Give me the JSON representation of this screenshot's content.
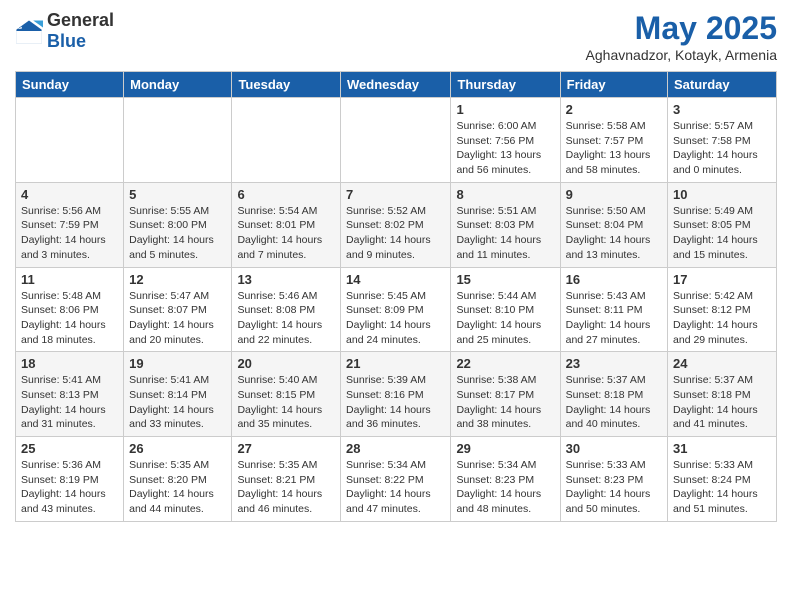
{
  "header": {
    "logo_general": "General",
    "logo_blue": "Blue",
    "title": "May 2025",
    "subtitle": "Aghavnadzor, Kotayk, Armenia"
  },
  "calendar": {
    "days_of_week": [
      "Sunday",
      "Monday",
      "Tuesday",
      "Wednesday",
      "Thursday",
      "Friday",
      "Saturday"
    ],
    "weeks": [
      [
        {
          "day": "",
          "info": ""
        },
        {
          "day": "",
          "info": ""
        },
        {
          "day": "",
          "info": ""
        },
        {
          "day": "",
          "info": ""
        },
        {
          "day": "1",
          "info": "Sunrise: 6:00 AM\nSunset: 7:56 PM\nDaylight: 13 hours\nand 56 minutes."
        },
        {
          "day": "2",
          "info": "Sunrise: 5:58 AM\nSunset: 7:57 PM\nDaylight: 13 hours\nand 58 minutes."
        },
        {
          "day": "3",
          "info": "Sunrise: 5:57 AM\nSunset: 7:58 PM\nDaylight: 14 hours\nand 0 minutes."
        }
      ],
      [
        {
          "day": "4",
          "info": "Sunrise: 5:56 AM\nSunset: 7:59 PM\nDaylight: 14 hours\nand 3 minutes."
        },
        {
          "day": "5",
          "info": "Sunrise: 5:55 AM\nSunset: 8:00 PM\nDaylight: 14 hours\nand 5 minutes."
        },
        {
          "day": "6",
          "info": "Sunrise: 5:54 AM\nSunset: 8:01 PM\nDaylight: 14 hours\nand 7 minutes."
        },
        {
          "day": "7",
          "info": "Sunrise: 5:52 AM\nSunset: 8:02 PM\nDaylight: 14 hours\nand 9 minutes."
        },
        {
          "day": "8",
          "info": "Sunrise: 5:51 AM\nSunset: 8:03 PM\nDaylight: 14 hours\nand 11 minutes."
        },
        {
          "day": "9",
          "info": "Sunrise: 5:50 AM\nSunset: 8:04 PM\nDaylight: 14 hours\nand 13 minutes."
        },
        {
          "day": "10",
          "info": "Sunrise: 5:49 AM\nSunset: 8:05 PM\nDaylight: 14 hours\nand 15 minutes."
        }
      ],
      [
        {
          "day": "11",
          "info": "Sunrise: 5:48 AM\nSunset: 8:06 PM\nDaylight: 14 hours\nand 18 minutes."
        },
        {
          "day": "12",
          "info": "Sunrise: 5:47 AM\nSunset: 8:07 PM\nDaylight: 14 hours\nand 20 minutes."
        },
        {
          "day": "13",
          "info": "Sunrise: 5:46 AM\nSunset: 8:08 PM\nDaylight: 14 hours\nand 22 minutes."
        },
        {
          "day": "14",
          "info": "Sunrise: 5:45 AM\nSunset: 8:09 PM\nDaylight: 14 hours\nand 24 minutes."
        },
        {
          "day": "15",
          "info": "Sunrise: 5:44 AM\nSunset: 8:10 PM\nDaylight: 14 hours\nand 25 minutes."
        },
        {
          "day": "16",
          "info": "Sunrise: 5:43 AM\nSunset: 8:11 PM\nDaylight: 14 hours\nand 27 minutes."
        },
        {
          "day": "17",
          "info": "Sunrise: 5:42 AM\nSunset: 8:12 PM\nDaylight: 14 hours\nand 29 minutes."
        }
      ],
      [
        {
          "day": "18",
          "info": "Sunrise: 5:41 AM\nSunset: 8:13 PM\nDaylight: 14 hours\nand 31 minutes."
        },
        {
          "day": "19",
          "info": "Sunrise: 5:41 AM\nSunset: 8:14 PM\nDaylight: 14 hours\nand 33 minutes."
        },
        {
          "day": "20",
          "info": "Sunrise: 5:40 AM\nSunset: 8:15 PM\nDaylight: 14 hours\nand 35 minutes."
        },
        {
          "day": "21",
          "info": "Sunrise: 5:39 AM\nSunset: 8:16 PM\nDaylight: 14 hours\nand 36 minutes."
        },
        {
          "day": "22",
          "info": "Sunrise: 5:38 AM\nSunset: 8:17 PM\nDaylight: 14 hours\nand 38 minutes."
        },
        {
          "day": "23",
          "info": "Sunrise: 5:37 AM\nSunset: 8:18 PM\nDaylight: 14 hours\nand 40 minutes."
        },
        {
          "day": "24",
          "info": "Sunrise: 5:37 AM\nSunset: 8:18 PM\nDaylight: 14 hours\nand 41 minutes."
        }
      ],
      [
        {
          "day": "25",
          "info": "Sunrise: 5:36 AM\nSunset: 8:19 PM\nDaylight: 14 hours\nand 43 minutes."
        },
        {
          "day": "26",
          "info": "Sunrise: 5:35 AM\nSunset: 8:20 PM\nDaylight: 14 hours\nand 44 minutes."
        },
        {
          "day": "27",
          "info": "Sunrise: 5:35 AM\nSunset: 8:21 PM\nDaylight: 14 hours\nand 46 minutes."
        },
        {
          "day": "28",
          "info": "Sunrise: 5:34 AM\nSunset: 8:22 PM\nDaylight: 14 hours\nand 47 minutes."
        },
        {
          "day": "29",
          "info": "Sunrise: 5:34 AM\nSunset: 8:23 PM\nDaylight: 14 hours\nand 48 minutes."
        },
        {
          "day": "30",
          "info": "Sunrise: 5:33 AM\nSunset: 8:23 PM\nDaylight: 14 hours\nand 50 minutes."
        },
        {
          "day": "31",
          "info": "Sunrise: 5:33 AM\nSunset: 8:24 PM\nDaylight: 14 hours\nand 51 minutes."
        }
      ]
    ]
  }
}
